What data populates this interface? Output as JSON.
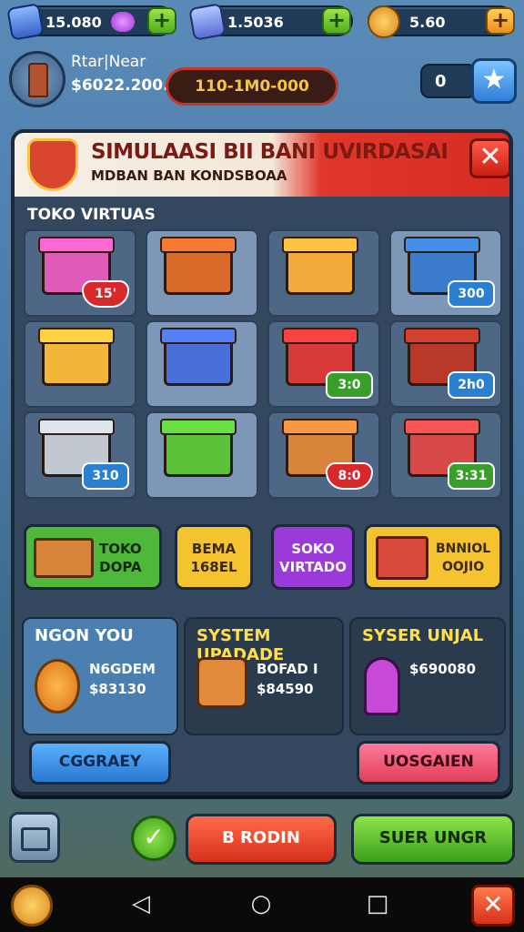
{
  "top_resources": [
    {
      "value": "15.080",
      "icon": "crystal-icon",
      "color": "#8a5cd6"
    },
    {
      "value": "1.5036",
      "icon": "crystal-icon",
      "color": "#5b7fd6"
    },
    {
      "value": "5.60",
      "icon": "gold-coin-icon",
      "color": "#f2a21b"
    }
  ],
  "profile": {
    "name": "Rtar|Near",
    "money": "$6022.200.0",
    "progress_text": "110-1M0-000",
    "count": "0"
  },
  "banner": {
    "title": "SIMULAASI BII BANI UVIRDASAI",
    "subtitle": "MDBAN BAN KONDSBOAA"
  },
  "store": {
    "section_title": "TOKO VIRTUAS",
    "items": [
      {
        "name": "pink-shop",
        "badge": "15'",
        "badge_style": "red",
        "color": "#e05ab8",
        "highlight": false
      },
      {
        "name": "market-stall",
        "badge": "",
        "badge_style": "none",
        "color": "#d86a2a",
        "highlight": true
      },
      {
        "name": "orange-shop",
        "badge": "",
        "badge_style": "none",
        "color": "#f2a93a",
        "highlight": false
      },
      {
        "name": "blue-building",
        "badge": "300",
        "badge_style": "blue",
        "color": "#3b7ccc",
        "highlight": true
      },
      {
        "name": "yellow-shop",
        "badge": "",
        "badge_style": "none",
        "color": "#f2b63a",
        "highlight": false
      },
      {
        "name": "blue-store",
        "badge": "",
        "badge_style": "none",
        "color": "#4a6fd8",
        "highlight": true
      },
      {
        "name": "striped-stall",
        "badge": "3:0",
        "badge_style": "green",
        "color": "#d83a3a",
        "highlight": false
      },
      {
        "name": "red-shop",
        "badge": "2h0",
        "badge_style": "blue",
        "color": "#b8382a",
        "highlight": false
      },
      {
        "name": "shopping-cart",
        "badge": "310",
        "badge_style": "blue",
        "color": "#c0c8d0",
        "highlight": false
      },
      {
        "name": "green-shop",
        "badge": "",
        "badge_style": "none",
        "color": "#5cc23a",
        "highlight": true
      },
      {
        "name": "box-shop",
        "badge": "8:0",
        "badge_style": "red",
        "color": "#d8843a",
        "highlight": false
      },
      {
        "name": "red-cart",
        "badge": "3:31",
        "badge_style": "green",
        "color": "#d84a4a",
        "highlight": false
      }
    ]
  },
  "categories": [
    {
      "line1": "TOKO",
      "line2": "DOPA",
      "color": "#4fb83a",
      "text_color": "#0f2a05"
    },
    {
      "line1": "BEMA",
      "line2": "168EL",
      "color": "#f5c230",
      "text_color": "#3a2a05"
    },
    {
      "line1": "SOKO",
      "line2": "VIRTADO",
      "color": "#9a3ad8",
      "text_color": "#ffffff"
    },
    {
      "line1": "BNNIOL",
      "line2": "OOJIO",
      "color": "#f5c230",
      "text_color": "#3a2a05"
    }
  ],
  "cards": [
    {
      "title": "NGON YOU",
      "line1": "N6GDEM",
      "line2": "$83130"
    },
    {
      "title": "SYSTEM UPADADE",
      "line1": "BOFAD I",
      "line2": "$84590"
    },
    {
      "title": "SYSER UNJAL",
      "line1": "$690080",
      "line2": ""
    }
  ],
  "card_buttons": {
    "left": "CGGRAEY",
    "right": "UOSGAIEN"
  },
  "bottom": {
    "red_button": "B RODIN",
    "green_button": "SUER UNGR"
  }
}
